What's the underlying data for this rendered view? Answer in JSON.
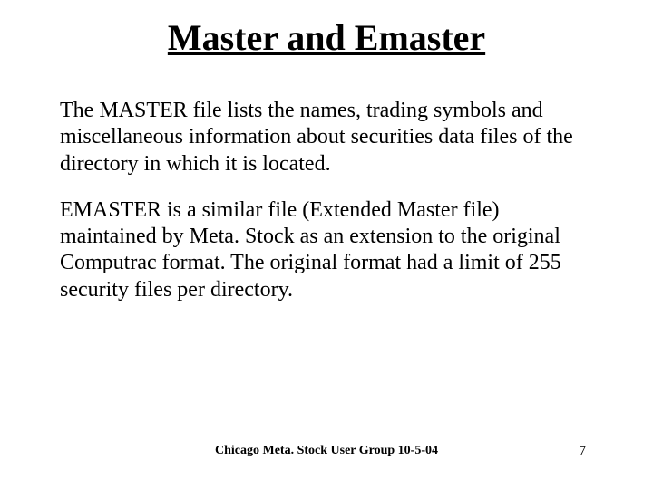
{
  "title": "Master and Emaster",
  "paragraphs": [
    "The MASTER file lists the names, trading symbols and miscellaneous information about securities data files of the directory in which it is located.",
    "EMASTER is a similar file (Extended Master file) maintained by Meta. Stock as an extension to the original Computrac format. The original format had a limit of 255 security files per directory."
  ],
  "footer": {
    "center": "Chicago Meta. Stock User Group 10-5-04",
    "page": "7"
  }
}
